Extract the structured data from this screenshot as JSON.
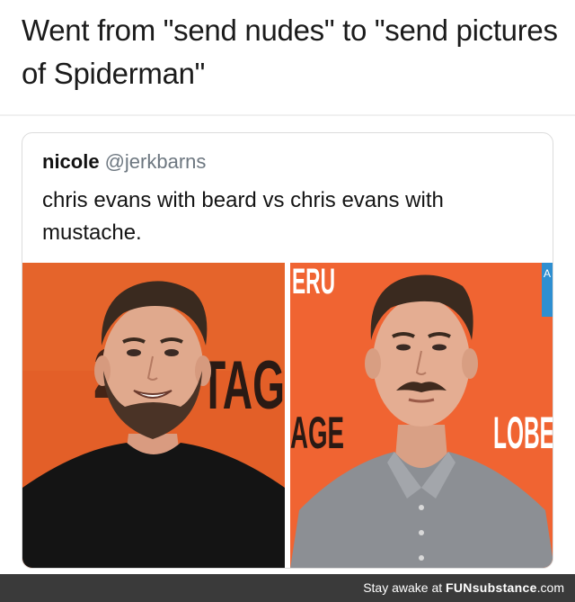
{
  "caption": "Went from \"send nudes\" to \"send pictures of Spiderman\"",
  "tweet": {
    "name": "nicole",
    "handle": "@jerkbarns",
    "text": "chris evans with beard vs chris evans with mustache."
  },
  "photos": {
    "left_backdrop_text": "TAG",
    "left_backdrop_number": "2",
    "right_backdrop_top": "ERU",
    "right_backdrop_mid": "AGE",
    "right_backdrop_right": "LOBE",
    "right_badge": "A",
    "colors": {
      "backdrop_left": "#e35f28",
      "backdrop_right": "#f06432"
    }
  },
  "footer": {
    "prefix": "Stay awake at ",
    "brand": "FUNsubstance",
    "suffix": ".com"
  }
}
